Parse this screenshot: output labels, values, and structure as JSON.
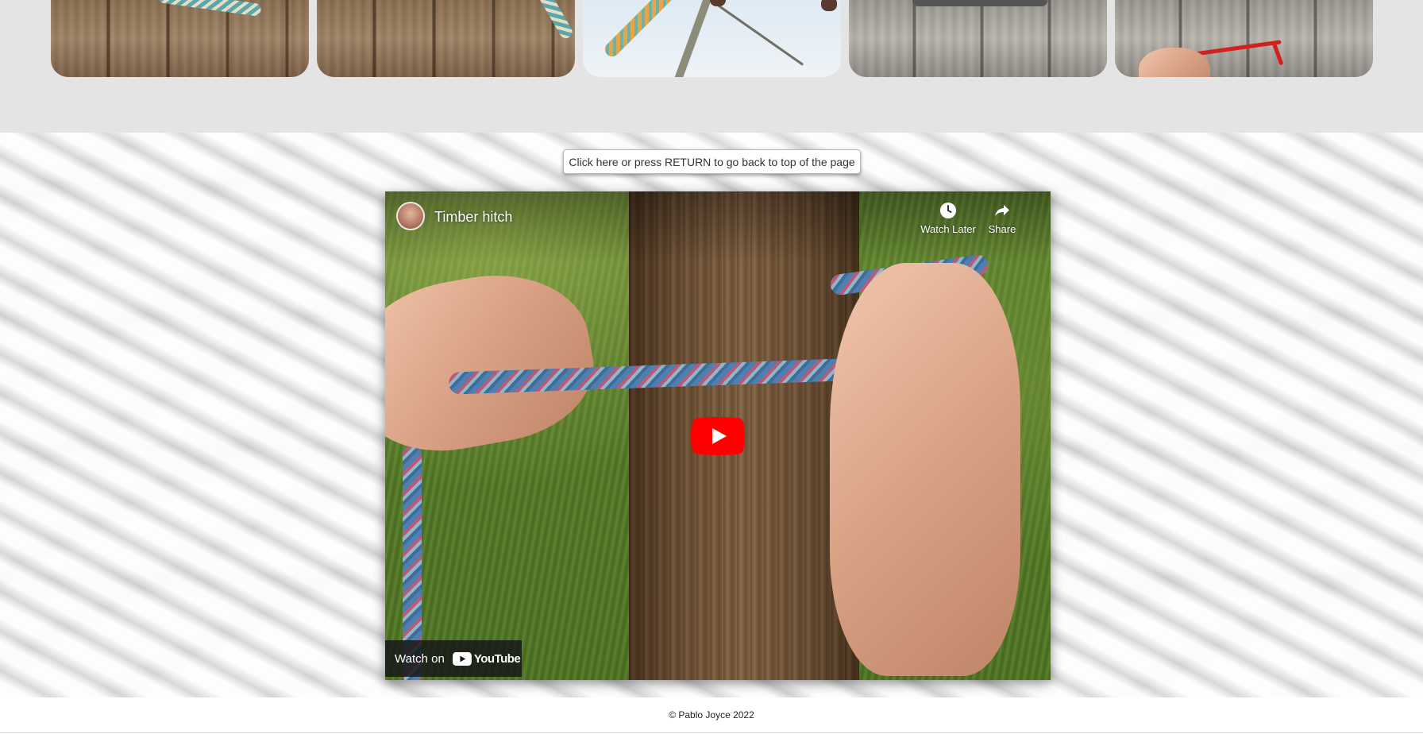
{
  "gallery": {
    "thumbnails": [
      {
        "icon": "rope-on-wood-image"
      },
      {
        "icon": "rope-on-wood-image"
      },
      {
        "icon": "rope-climbing-frame-image"
      },
      {
        "icon": "rope-on-wood-image"
      },
      {
        "icon": "red-cord-on-wood-image"
      }
    ]
  },
  "back_to_top": {
    "label": "Click here or press RETURN to go back to top of the page"
  },
  "video": {
    "title": "Timber hitch",
    "watch_later_label": "Watch Later",
    "share_label": "Share",
    "watch_on_label": "Watch on",
    "youtube_wordmark": "YouTube",
    "colors": {
      "play_button": "#ff0000",
      "overlay": "#171717"
    }
  },
  "footer": {
    "copyright": "© Pablo Joyce 2022"
  }
}
